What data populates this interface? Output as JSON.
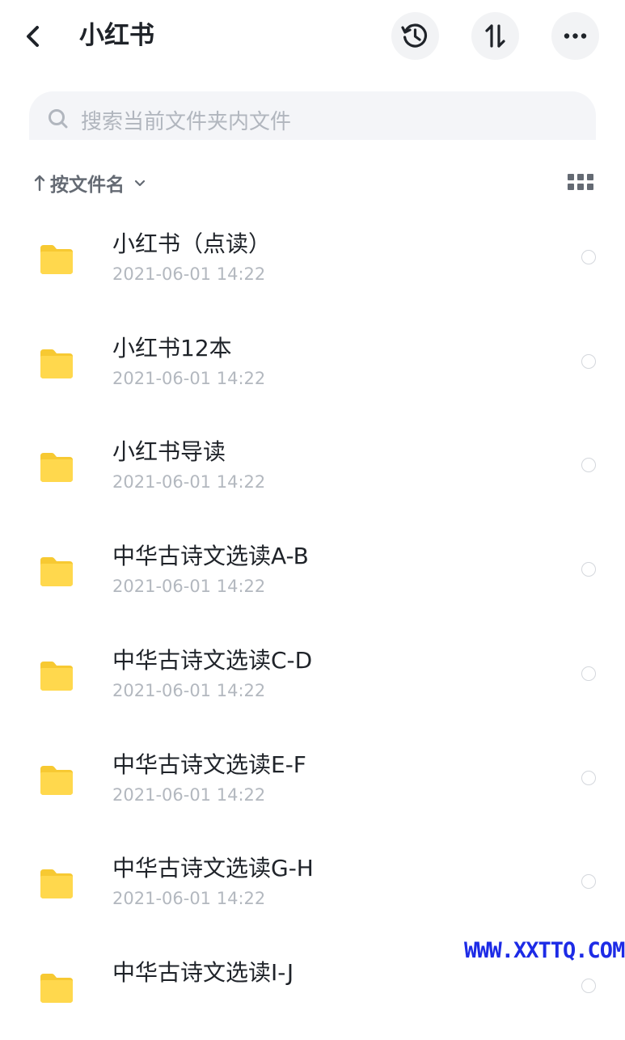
{
  "header": {
    "title": "小红书",
    "back_icon": "chevron-left-icon",
    "actions": [
      {
        "name": "history-button",
        "icon": "history-icon"
      },
      {
        "name": "sort-toggle-button",
        "icon": "up-down-arrows-icon"
      },
      {
        "name": "more-button",
        "icon": "more-horizontal-icon"
      }
    ]
  },
  "search": {
    "placeholder": "搜索当前文件夹内文件",
    "value": ""
  },
  "sort": {
    "label": "按文件名",
    "direction_icon": "arrow-up-icon",
    "dropdown_icon": "chevron-down-icon",
    "view_icon": "grid-view-icon"
  },
  "files": [
    {
      "name": "小红书（点读）",
      "date": "2021-06-01 14:22"
    },
    {
      "name": "小红书12本",
      "date": "2021-06-01 14:22"
    },
    {
      "name": "小红书导读",
      "date": "2021-06-01 14:22"
    },
    {
      "name": "中华古诗文选读A-B",
      "date": "2021-06-01 14:22"
    },
    {
      "name": "中华古诗文选读C-D",
      "date": "2021-06-01 14:22"
    },
    {
      "name": "中华古诗文选读E-F",
      "date": "2021-06-01 14:22"
    },
    {
      "name": "中华古诗文选读G-H",
      "date": "2021-06-01 14:22"
    },
    {
      "name": "中华古诗文选读I-J",
      "date": ""
    }
  ],
  "watermark": "WWW.XXTTQ.COM",
  "colors": {
    "folder": "#ffd84d",
    "folder_dark": "#f7c932",
    "watermark": "#1d2be6"
  }
}
